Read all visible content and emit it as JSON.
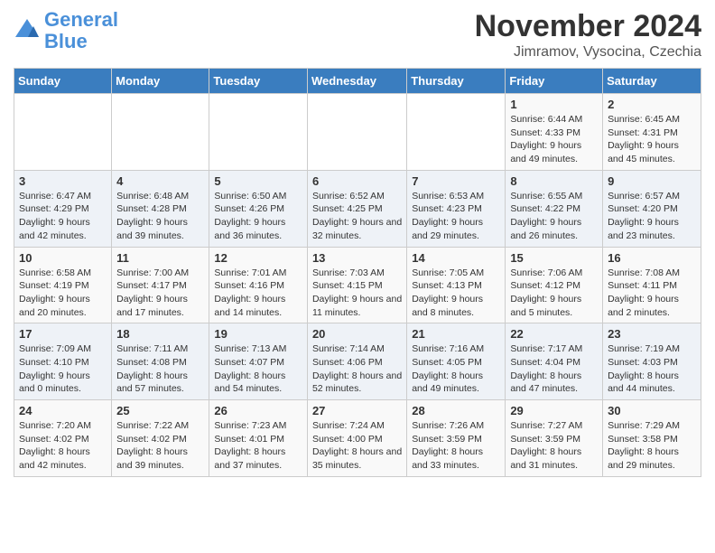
{
  "header": {
    "logo_line1": "General",
    "logo_line2": "Blue",
    "title": "November 2024",
    "subtitle": "Jimramov, Vysocina, Czechia"
  },
  "weekdays": [
    "Sunday",
    "Monday",
    "Tuesday",
    "Wednesday",
    "Thursday",
    "Friday",
    "Saturday"
  ],
  "weeks": [
    [
      {
        "day": "",
        "info": ""
      },
      {
        "day": "",
        "info": ""
      },
      {
        "day": "",
        "info": ""
      },
      {
        "day": "",
        "info": ""
      },
      {
        "day": "",
        "info": ""
      },
      {
        "day": "1",
        "info": "Sunrise: 6:44 AM\nSunset: 4:33 PM\nDaylight: 9 hours and 49 minutes."
      },
      {
        "day": "2",
        "info": "Sunrise: 6:45 AM\nSunset: 4:31 PM\nDaylight: 9 hours and 45 minutes."
      }
    ],
    [
      {
        "day": "3",
        "info": "Sunrise: 6:47 AM\nSunset: 4:29 PM\nDaylight: 9 hours and 42 minutes."
      },
      {
        "day": "4",
        "info": "Sunrise: 6:48 AM\nSunset: 4:28 PM\nDaylight: 9 hours and 39 minutes."
      },
      {
        "day": "5",
        "info": "Sunrise: 6:50 AM\nSunset: 4:26 PM\nDaylight: 9 hours and 36 minutes."
      },
      {
        "day": "6",
        "info": "Sunrise: 6:52 AM\nSunset: 4:25 PM\nDaylight: 9 hours and 32 minutes."
      },
      {
        "day": "7",
        "info": "Sunrise: 6:53 AM\nSunset: 4:23 PM\nDaylight: 9 hours and 29 minutes."
      },
      {
        "day": "8",
        "info": "Sunrise: 6:55 AM\nSunset: 4:22 PM\nDaylight: 9 hours and 26 minutes."
      },
      {
        "day": "9",
        "info": "Sunrise: 6:57 AM\nSunset: 4:20 PM\nDaylight: 9 hours and 23 minutes."
      }
    ],
    [
      {
        "day": "10",
        "info": "Sunrise: 6:58 AM\nSunset: 4:19 PM\nDaylight: 9 hours and 20 minutes."
      },
      {
        "day": "11",
        "info": "Sunrise: 7:00 AM\nSunset: 4:17 PM\nDaylight: 9 hours and 17 minutes."
      },
      {
        "day": "12",
        "info": "Sunrise: 7:01 AM\nSunset: 4:16 PM\nDaylight: 9 hours and 14 minutes."
      },
      {
        "day": "13",
        "info": "Sunrise: 7:03 AM\nSunset: 4:15 PM\nDaylight: 9 hours and 11 minutes."
      },
      {
        "day": "14",
        "info": "Sunrise: 7:05 AM\nSunset: 4:13 PM\nDaylight: 9 hours and 8 minutes."
      },
      {
        "day": "15",
        "info": "Sunrise: 7:06 AM\nSunset: 4:12 PM\nDaylight: 9 hours and 5 minutes."
      },
      {
        "day": "16",
        "info": "Sunrise: 7:08 AM\nSunset: 4:11 PM\nDaylight: 9 hours and 2 minutes."
      }
    ],
    [
      {
        "day": "17",
        "info": "Sunrise: 7:09 AM\nSunset: 4:10 PM\nDaylight: 9 hours and 0 minutes."
      },
      {
        "day": "18",
        "info": "Sunrise: 7:11 AM\nSunset: 4:08 PM\nDaylight: 8 hours and 57 minutes."
      },
      {
        "day": "19",
        "info": "Sunrise: 7:13 AM\nSunset: 4:07 PM\nDaylight: 8 hours and 54 minutes."
      },
      {
        "day": "20",
        "info": "Sunrise: 7:14 AM\nSunset: 4:06 PM\nDaylight: 8 hours and 52 minutes."
      },
      {
        "day": "21",
        "info": "Sunrise: 7:16 AM\nSunset: 4:05 PM\nDaylight: 8 hours and 49 minutes."
      },
      {
        "day": "22",
        "info": "Sunrise: 7:17 AM\nSunset: 4:04 PM\nDaylight: 8 hours and 47 minutes."
      },
      {
        "day": "23",
        "info": "Sunrise: 7:19 AM\nSunset: 4:03 PM\nDaylight: 8 hours and 44 minutes."
      }
    ],
    [
      {
        "day": "24",
        "info": "Sunrise: 7:20 AM\nSunset: 4:02 PM\nDaylight: 8 hours and 42 minutes."
      },
      {
        "day": "25",
        "info": "Sunrise: 7:22 AM\nSunset: 4:02 PM\nDaylight: 8 hours and 39 minutes."
      },
      {
        "day": "26",
        "info": "Sunrise: 7:23 AM\nSunset: 4:01 PM\nDaylight: 8 hours and 37 minutes."
      },
      {
        "day": "27",
        "info": "Sunrise: 7:24 AM\nSunset: 4:00 PM\nDaylight: 8 hours and 35 minutes."
      },
      {
        "day": "28",
        "info": "Sunrise: 7:26 AM\nSunset: 3:59 PM\nDaylight: 8 hours and 33 minutes."
      },
      {
        "day": "29",
        "info": "Sunrise: 7:27 AM\nSunset: 3:59 PM\nDaylight: 8 hours and 31 minutes."
      },
      {
        "day": "30",
        "info": "Sunrise: 7:29 AM\nSunset: 3:58 PM\nDaylight: 8 hours and 29 minutes."
      }
    ]
  ]
}
